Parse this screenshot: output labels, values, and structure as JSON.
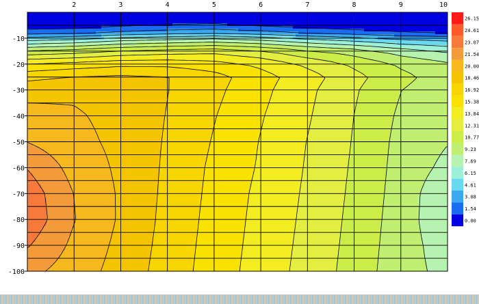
{
  "chart_data": {
    "type": "heatmap",
    "x_ticks": [
      "2",
      "3",
      "4",
      "5",
      "6",
      "7",
      "8",
      "9",
      "10"
    ],
    "y_ticks": [
      "-10",
      "-20",
      "-30",
      "-40",
      "-50",
      "-60",
      "-70",
      "-80",
      "-90",
      "-100"
    ],
    "x_range": [
      1.0,
      10.0
    ],
    "y_range": [
      0,
      -100
    ],
    "grid": true,
    "contour_lines": true,
    "legend_position": "right",
    "legend_levels": [
      "26.15",
      "24.61",
      "23.07",
      "21.54",
      "20.00",
      "18.46",
      "16.92",
      "15.38",
      "13.84",
      "12.31",
      "10.77",
      "9.23",
      "7.69",
      "6.15",
      "4.61",
      "3.08",
      "1.54",
      "0.00"
    ],
    "legend_colors": [
      "#ff1a1a",
      "#ff5a2a",
      "#f77a3a",
      "#f39a3a",
      "#f6b81c",
      "#f5c400",
      "#f7d500",
      "#f9e100",
      "#f2ec20",
      "#e4ee40",
      "#ccec48",
      "#bfee70",
      "#b6f2b0",
      "#9cf0d8",
      "#6ad8f0",
      "#3aa8f0",
      "#1a6cf0",
      "#0000e0"
    ],
    "z_rows_depth": [
      0,
      -5,
      -8,
      -10,
      -15,
      -20,
      -25,
      -30,
      -40,
      -50,
      -60,
      -70,
      -80,
      -90,
      -100
    ],
    "z_cols_x": [
      1,
      2,
      3,
      4,
      5,
      6,
      7,
      8,
      9,
      10
    ],
    "z": [
      [
        0.0,
        0.0,
        0.0,
        0.0,
        0.0,
        0.0,
        0.0,
        0.0,
        0.0,
        0.0
      ],
      [
        0.5,
        0.6,
        1.2,
        1.6,
        1.8,
        1.2,
        0.8,
        0.4,
        0.2,
        0.1
      ],
      [
        2.5,
        2.8,
        3.5,
        4.0,
        4.3,
        3.8,
        3.0,
        2.4,
        1.8,
        1.5
      ],
      [
        5.0,
        5.5,
        6.5,
        7.0,
        7.5,
        6.8,
        5.8,
        5.0,
        4.2,
        3.8
      ],
      [
        11.0,
        11.5,
        12.5,
        13.0,
        13.3,
        12.5,
        11.0,
        10.0,
        8.5,
        7.5
      ],
      [
        15.5,
        16.0,
        16.5,
        16.5,
        16.0,
        15.0,
        13.5,
        12.0,
        10.5,
        9.5
      ],
      [
        18.0,
        18.5,
        18.8,
        18.5,
        17.5,
        16.0,
        14.5,
        12.8,
        11.2,
        10.0
      ],
      [
        19.5,
        19.7,
        19.3,
        18.5,
        17.3,
        15.8,
        14.2,
        12.5,
        10.8,
        9.8
      ],
      [
        20.5,
        20.2,
        19.5,
        18.4,
        17.0,
        15.5,
        14.0,
        12.3,
        10.5,
        9.5
      ],
      [
        21.5,
        20.5,
        19.6,
        18.3,
        16.8,
        15.3,
        13.8,
        12.2,
        10.3,
        9.3
      ],
      [
        23.0,
        21.0,
        19.7,
        18.2,
        16.6,
        15.2,
        13.7,
        12.1,
        10.2,
        8.8
      ],
      [
        24.0,
        21.5,
        19.8,
        18.1,
        16.5,
        15.0,
        13.6,
        12.0,
        10.1,
        8.0
      ],
      [
        24.2,
        21.6,
        19.8,
        18.0,
        16.4,
        14.9,
        13.5,
        11.9,
        10.0,
        8.0
      ],
      [
        23.2,
        21.2,
        19.6,
        17.9,
        16.3,
        14.8,
        13.4,
        11.8,
        9.9,
        8.5
      ],
      [
        22.0,
        20.8,
        19.4,
        17.8,
        16.2,
        14.7,
        13.3,
        11.7,
        9.8,
        8.8
      ]
    ]
  }
}
